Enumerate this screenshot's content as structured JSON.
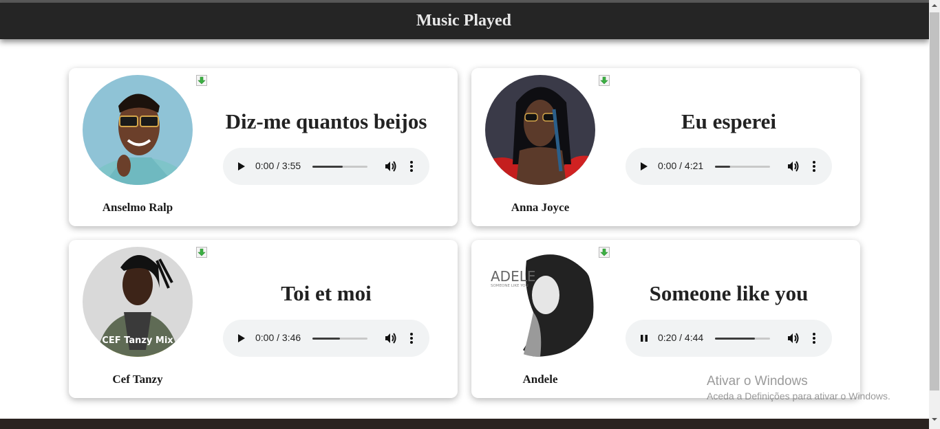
{
  "header": {
    "title": "Music Played"
  },
  "cards": [
    {
      "title": "Diz-me quantos beijos",
      "artist": "Anselmo Ralp",
      "time": "0:00 / 3:55",
      "progress": 0.55,
      "state": "paused"
    },
    {
      "title": "Eu esperei",
      "artist": "Anna Joyce",
      "time": "0:00 / 4:21",
      "progress": 0.27,
      "state": "paused"
    },
    {
      "title": "Toi et moi",
      "artist": "Cef Tanzy",
      "time": "0:00 / 3:46",
      "progress": 0.5,
      "state": "paused",
      "cover_text": "CEF Tanzy Mix"
    },
    {
      "title": "Someone like you",
      "artist": "Andele",
      "time": "0:20 / 4:44",
      "progress": 0.72,
      "state": "playing",
      "cover_text": "ADELE",
      "cover_subtext": "SOMEONE LIKE YOU"
    }
  ],
  "watermark": {
    "line1": "Ativar o Windows",
    "line2": "Aceda a Definições para ativar o Windows."
  },
  "icons": {
    "download": "download-icon",
    "play": "play-icon",
    "pause": "pause-icon",
    "volume": "volume-icon",
    "more": "more-options-icon"
  },
  "colors": {
    "header_bg": "#252525",
    "player_bg": "#f1f3f4",
    "download_arrow": "#3cb043"
  }
}
